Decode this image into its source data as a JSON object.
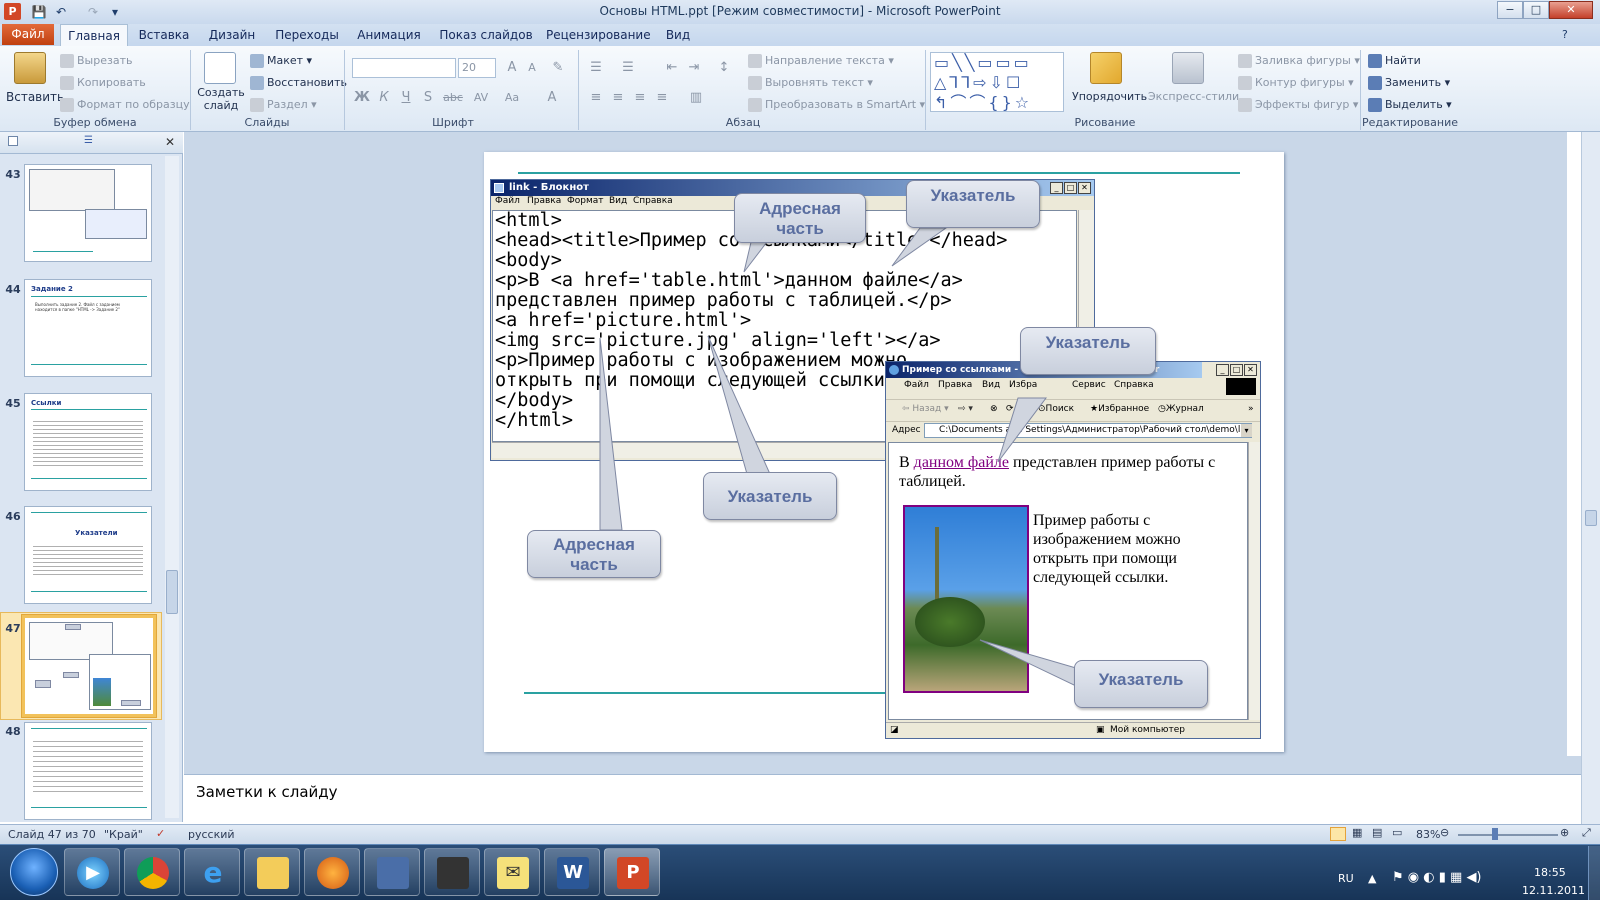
{
  "window": {
    "title": "Основы HTML.ppt [Режим совместимости]  -  Microsoft PowerPoint",
    "app_icon": "P",
    "controls": {
      "minimize": "−",
      "maximize": "□",
      "close": "✕"
    }
  },
  "qat": {
    "save": "💾",
    "undo": "↶",
    "redo": "↷",
    "customize": "▾"
  },
  "tabs": [
    {
      "label": "Файл"
    },
    {
      "label": "Главная"
    },
    {
      "label": "Вставка"
    },
    {
      "label": "Дизайн"
    },
    {
      "label": "Переходы"
    },
    {
      "label": "Анимация"
    },
    {
      "label": "Показ слайдов"
    },
    {
      "label": "Рецензирование"
    },
    {
      "label": "Вид"
    }
  ],
  "ribbon": {
    "clipboard": {
      "paste": "Вставить",
      "cut": "Вырезать",
      "copy": "Копировать",
      "format_painter": "Формат по образцу",
      "group": "Буфер обмена"
    },
    "slides": {
      "new_slide": "Создать слайд",
      "layout": "Макет",
      "reset": "Восстановить",
      "section": "Раздел",
      "group": "Слайды"
    },
    "font": {
      "font_name": "",
      "font_size": "20",
      "group": "Шрифт",
      "buttons": [
        "Ж",
        "К",
        "Ч",
        "S",
        "abc",
        "AV",
        "Aa",
        "A"
      ]
    },
    "paragraph": {
      "text_direction": "Направление текста",
      "align_text": "Выровнять текст",
      "smartart": "Преобразовать в SmartArt",
      "group": "Абзац"
    },
    "drawing": {
      "arrange": "Упорядочить",
      "quick_styles": "Экспресс-стили",
      "shape_fill": "Заливка фигуры",
      "shape_outline": "Контур фигуры",
      "shape_effects": "Эффекты фигур",
      "group": "Рисование"
    },
    "editing": {
      "find": "Найти",
      "replace": "Заменить",
      "select": "Выделить",
      "group": "Редактирование"
    }
  },
  "slides_panel": {
    "thumbs": [
      {
        "num": "43",
        "title": ""
      },
      {
        "num": "44",
        "title": "Задание 2",
        "text": "Выполнить задание 2. Файл с заданием находится в папке \"HTML -> Задание 2\""
      },
      {
        "num": "45",
        "title": "Ссылки"
      },
      {
        "num": "46",
        "title": "Указатели"
      },
      {
        "num": "47",
        "title": ""
      },
      {
        "num": "48",
        "title": ""
      }
    ]
  },
  "notepad": {
    "title": "link - Блокнот",
    "menu": [
      "Файл",
      "Правка",
      "Формат",
      "Вид",
      "Справка"
    ],
    "code": "<html>\n<head><title>Пример со ссылками</title></head>\n<body>\n<p>В <a href='table.html'>данном файле</a>\nпредставлен пример работы с таблицей.</p>\n<a href='picture.html'>\n<img src='picture.jpg' align='left'></a>\n<p>Пример работы с изображением можно\nоткрыть при помощи следующей ссылки.</p>\n</body>\n</html>"
  },
  "browser": {
    "title": "Пример со ссылками - Microsoft Internet Explorer",
    "menu": [
      "Файл",
      "Правка",
      "Вид",
      "Избранное",
      "Сервис",
      "Справка"
    ],
    "toolbar": {
      "back": "Назад",
      "search": "Поиск",
      "favorites": "Избранное",
      "journal": "Журнал"
    },
    "address_label": "Адрес",
    "address": "C:\\Documents and Settings\\Администратор\\Рабочий стол\\demo\\link.htm",
    "content": {
      "p1_before": "В ",
      "link_text": "данном файле",
      "p1_after": " представлен пример работы с таблицей.",
      "p2": "Пример работы с изображением можно открыть при помощи следующей ссылки."
    },
    "status": "Мой компьютер"
  },
  "callouts": {
    "addr_top": "Адресная часть",
    "pointer_top": "Указатель",
    "pointer_mid": "Указатель",
    "pointer_low": "Указатель",
    "addr_low": "Адресная часть",
    "pointer_img": "Указатель"
  },
  "notes": {
    "placeholder": "Заметки к слайду"
  },
  "status_bar": {
    "slide_info": "Слайд 47 из 70",
    "theme": "\"Край\"",
    "language": "русский",
    "zoom": "83%"
  },
  "taskbar": {
    "lang": "RU",
    "time": "18:55",
    "date": "12.11.2011"
  },
  "colors": {
    "accent": "#d24726",
    "link": "#800080",
    "teal": "#2aa1a1"
  }
}
